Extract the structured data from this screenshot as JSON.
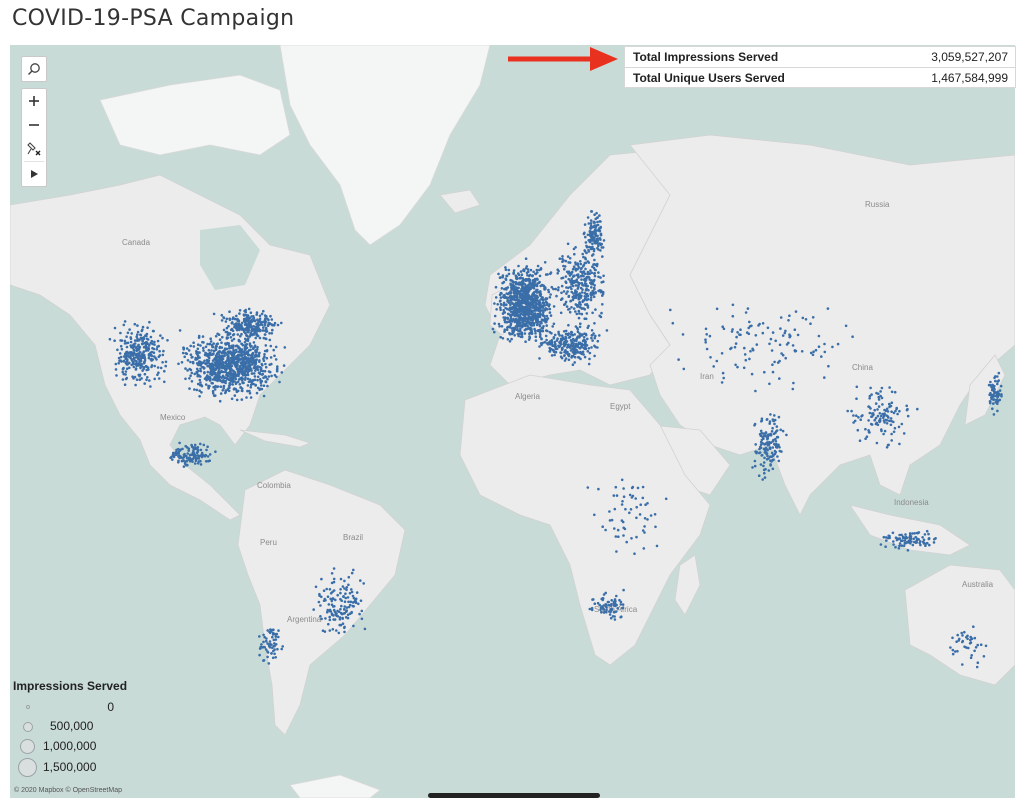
{
  "page": {
    "title": "COVID-19-PSA Campaign"
  },
  "summary": {
    "rows": [
      {
        "label": "Total Impressions Served",
        "value": "3,059,527,207"
      },
      {
        "label": "Total Unique Users Served",
        "value": "1,467,584,999"
      }
    ]
  },
  "map": {
    "country_labels": [
      "Canada",
      "Russia",
      "Algeria",
      "Egypt",
      "Iran",
      "China",
      "Mexico",
      "Colombia",
      "Peru",
      "Brazil",
      "Indonesia",
      "Australia",
      "South Africa",
      "Argentina"
    ],
    "attribution": "© 2020 Mapbox © OpenStreetMap",
    "colors": {
      "water": "#c9dbd7",
      "land": "#ececec",
      "dots": "#3a6ea8",
      "arrow": "#e8321f"
    }
  },
  "toolbar": {
    "icons": [
      "search-icon",
      "zoom-in-icon",
      "zoom-out-icon",
      "pin-clear-icon",
      "play-icon"
    ]
  },
  "legend": {
    "title": "Impressions Served",
    "items": [
      "0",
      "500,000",
      "1,000,000",
      "1,500,000"
    ]
  }
}
